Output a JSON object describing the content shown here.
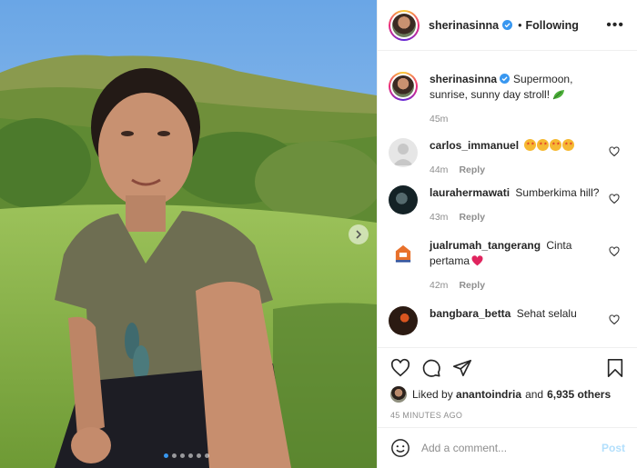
{
  "post_author": {
    "username": "sherinasinna",
    "follow_separator": "•",
    "follow_status": "Following"
  },
  "caption": {
    "username": "sherinasinna",
    "text": "Supermoon, sunrise, sunny day stroll!",
    "time": "45m"
  },
  "comments": [
    {
      "username": "carlos_immanuel",
      "text": "",
      "emoji_count": 4,
      "time": "44m",
      "reply": "Reply"
    },
    {
      "username": "laurahermawati",
      "text": "Sumberkima hill?",
      "time": "43m",
      "reply": "Reply"
    },
    {
      "username": "jualrumah_tangerang",
      "text": "Cinta pertama",
      "time": "42m",
      "reply": "Reply"
    },
    {
      "username": "bangbara_betta",
      "text": "Sehat selalu"
    }
  ],
  "likes": {
    "prefix": "Liked by",
    "user": "anantoindria",
    "and": "and",
    "others": "6,935 others"
  },
  "timestamp": "45 MINUTES AGO",
  "add_comment": {
    "placeholder": "Add a comment...",
    "post_label": "Post"
  },
  "carousel": {
    "total": 6,
    "active_index": 0
  },
  "icons": [
    "more-icon",
    "verified-icon",
    "heart-icon",
    "comment-icon",
    "share-icon",
    "bookmark-icon",
    "emoji-icon",
    "next-icon"
  ],
  "colors": {
    "link_blue": "#0095f6",
    "post_disabled": "#b2dffc",
    "verified": "#3897f0",
    "muted": "#8e8e8e"
  }
}
